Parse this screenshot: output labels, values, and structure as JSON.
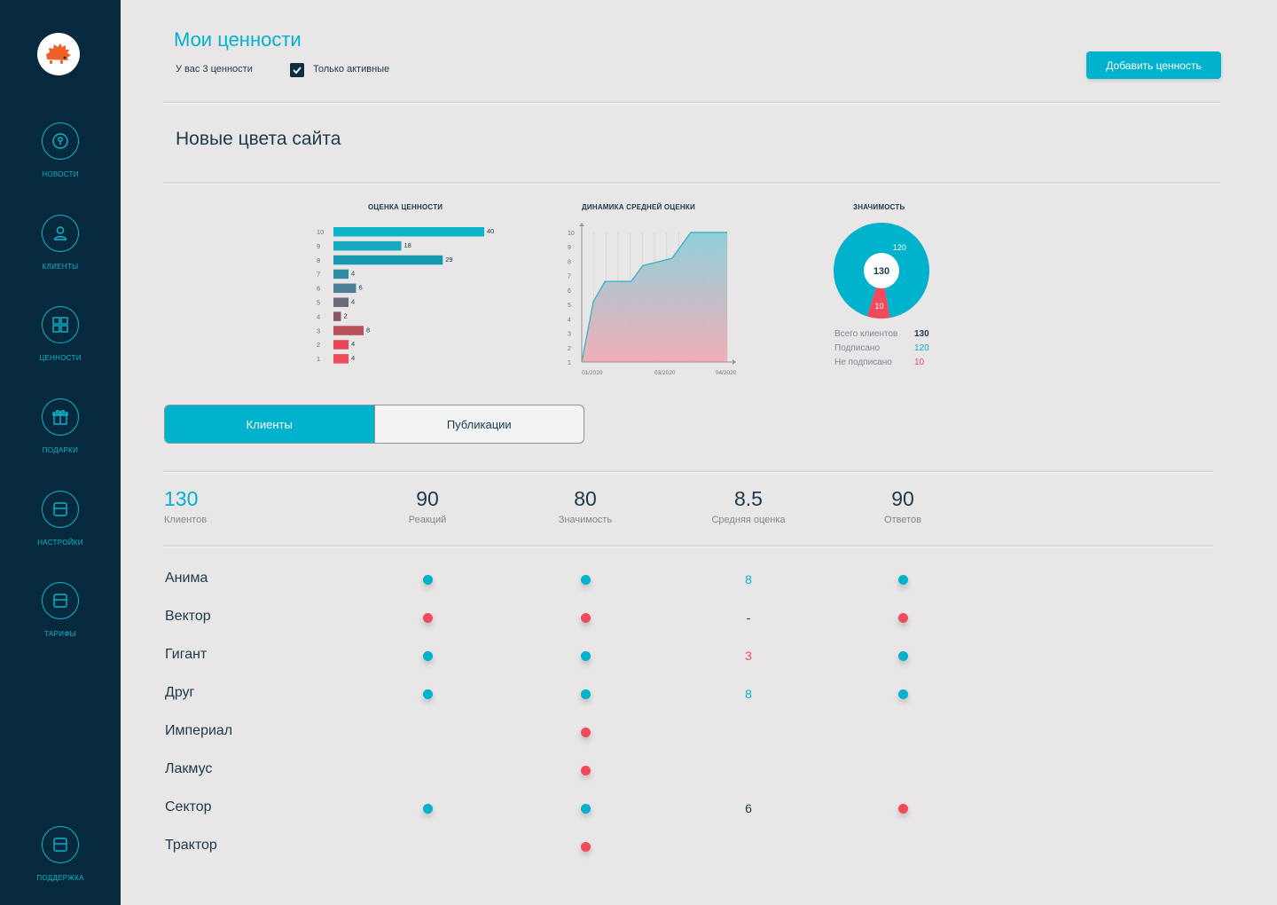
{
  "sidebar": {
    "items": [
      {
        "label": "новости",
        "icon": "news-icon"
      },
      {
        "label": "клиенты",
        "icon": "user-icon"
      },
      {
        "label": "ценности",
        "icon": "grid-icon"
      },
      {
        "label": "подарки",
        "icon": "gift-icon"
      },
      {
        "label": "настройки",
        "icon": "settings-icon"
      },
      {
        "label": "тарифы",
        "icon": "tariff-icon"
      }
    ],
    "support": {
      "label": "поддержка",
      "icon": "support-icon"
    }
  },
  "header": {
    "title": "Мои ценности",
    "count_text": "У вас 3 ценности",
    "active_only_label": "Только активные",
    "active_only_checked": true,
    "add_button": "Добавить ценность"
  },
  "value_title": "Новые цвета сайта",
  "charts": {
    "rating": {
      "title": "ОЦЕНКА ЦЕННОСТИ",
      "chart_data": {
        "type": "bar",
        "orientation": "horizontal",
        "title": "ОЦЕНКА ЦЕННОСТИ",
        "categories": [
          "10",
          "9",
          "8",
          "7",
          "6",
          "5",
          "4",
          "3",
          "2",
          "1"
        ],
        "values": [
          40,
          18,
          29,
          4,
          6,
          4,
          2,
          8,
          4,
          4
        ],
        "colors": [
          "#0fb3c9",
          "#15a8bf",
          "#1799af",
          "#2f8aa3",
          "#4a7f97",
          "#6a6c7c",
          "#8c5466",
          "#b9505c",
          "#e44656",
          "#f14a5b"
        ]
      }
    },
    "dynamics": {
      "title": "ДИНАМИКА СРЕДНЕЙ ОЦЕНКИ",
      "chart_data": {
        "type": "area",
        "title": "ДИНАМИКА СРЕДНЕЙ ОЦЕНКИ",
        "yticks": [
          "1",
          "2",
          "3",
          "4",
          "5",
          "6",
          "7",
          "8",
          "9",
          "10"
        ],
        "xticks": [
          "01/2020",
          "03/2020",
          "04/2020"
        ],
        "ylim": [
          1,
          10
        ],
        "x": [
          0,
          0.08,
          0.16,
          0.34,
          0.42,
          0.62,
          0.75,
          0.9,
          1.0
        ],
        "y": [
          1,
          5.2,
          6.6,
          6.6,
          7.7,
          8.2,
          10,
          10,
          10
        ]
      }
    },
    "significance": {
      "title": "ЗНАЧИМОСТЬ",
      "chart_data": {
        "type": "pie",
        "title": "ЗНАЧИМОСТЬ",
        "center_label": "130",
        "slices": [
          {
            "name": "Подписано",
            "value": 120,
            "color": "#00b2cc"
          },
          {
            "name": "Не подписано",
            "value": 10,
            "color": "#f14a5b"
          }
        ]
      },
      "legend": [
        {
          "label": "Всего клиентов",
          "value": "130",
          "color": "#1d3a4a"
        },
        {
          "label": "Подписано",
          "value": "120",
          "color": "#00b2cc"
        },
        {
          "label": "Не подписано",
          "value": "10",
          "color": "#f14a5b"
        }
      ]
    }
  },
  "tabs": [
    {
      "label": "Клиенты",
      "active": true
    },
    {
      "label": "Публикации",
      "active": false
    }
  ],
  "stats": [
    {
      "value": "130",
      "label": "Клиентов"
    },
    {
      "value": "90",
      "label": "Реакций"
    },
    {
      "value": "80",
      "label": "Значимость"
    },
    {
      "value": "8.5",
      "label": "Средняя оценка"
    },
    {
      "value": "90",
      "label": "Ответов"
    }
  ],
  "colors": {
    "accent": "#00b2cc",
    "negative": "#f14a5b",
    "sidebar": "#06293d"
  },
  "rows": [
    {
      "name": "Анима",
      "reactions": "cyan",
      "significance": "cyan",
      "rating": "8",
      "rating_color": "#00b2cc",
      "answers": "cyan"
    },
    {
      "name": "Вектор",
      "reactions": "red",
      "significance": "red",
      "rating": "-",
      "rating_color": "#1d3a4a",
      "answers": "red"
    },
    {
      "name": "Гигант",
      "reactions": "cyan",
      "significance": "cyan",
      "rating": "3",
      "rating_color": "#f14a5b",
      "answers": "cyan"
    },
    {
      "name": "Друг",
      "reactions": "cyan",
      "significance": "cyan",
      "rating": "8",
      "rating_color": "#00b2cc",
      "answers": "cyan"
    },
    {
      "name": "Империал",
      "reactions": null,
      "significance": "red",
      "rating": null,
      "rating_color": null,
      "answers": null
    },
    {
      "name": "Лакмус",
      "reactions": null,
      "significance": "red",
      "rating": null,
      "rating_color": null,
      "answers": null
    },
    {
      "name": "Сектор",
      "reactions": "cyan",
      "significance": "cyan",
      "rating": "6",
      "rating_color": "#1d3a4a",
      "answers": "red"
    },
    {
      "name": "Трактор",
      "reactions": null,
      "significance": "red",
      "rating": null,
      "rating_color": null,
      "answers": null
    }
  ]
}
